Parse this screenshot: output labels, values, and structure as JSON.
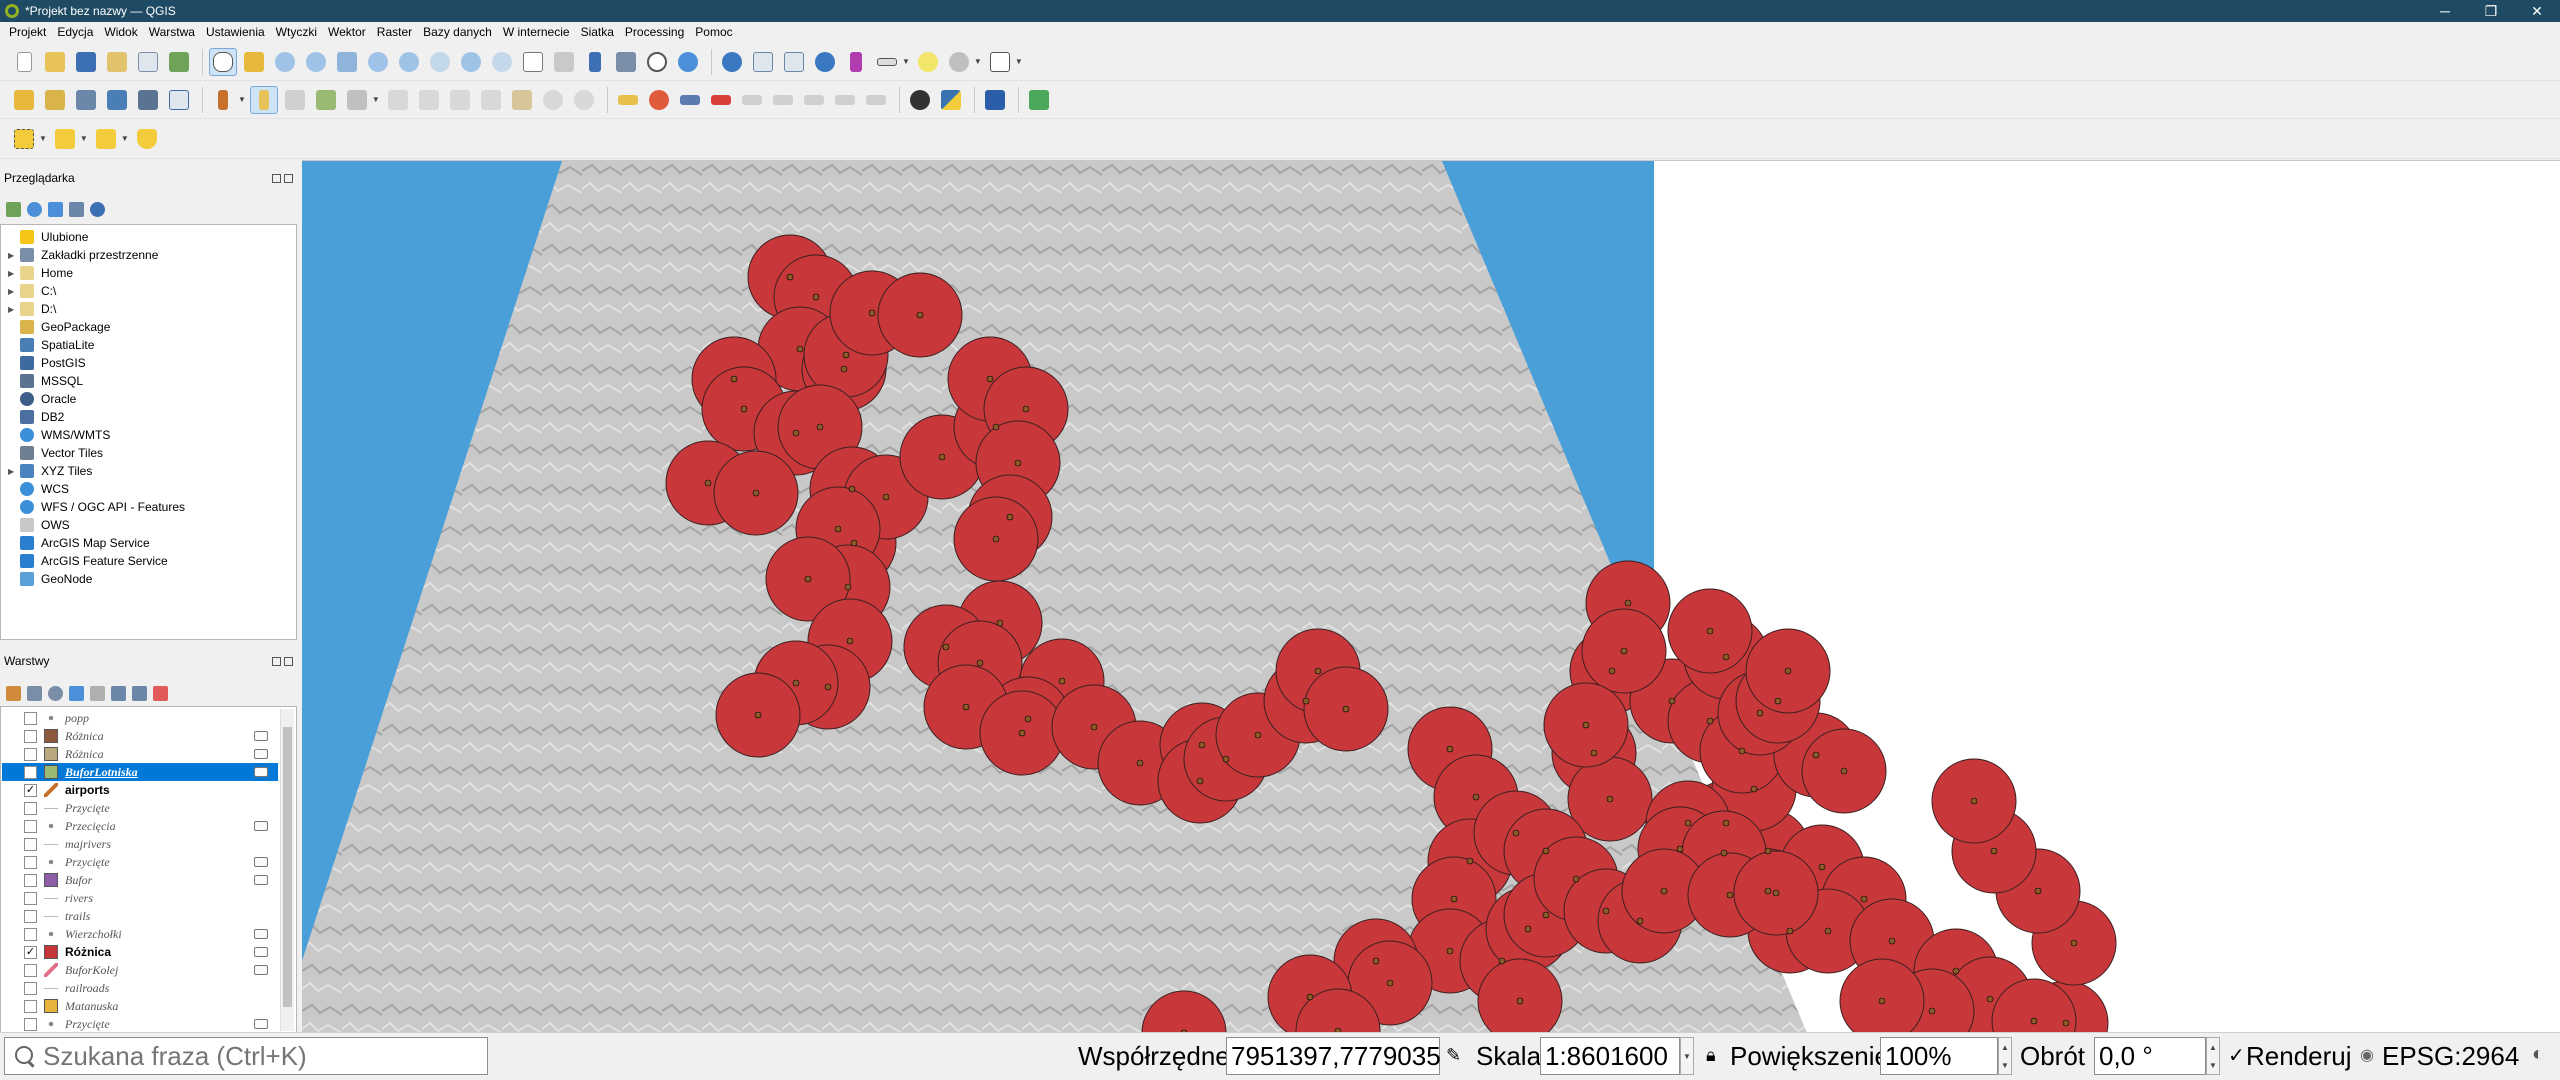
{
  "window": {
    "title": "*Projekt bez nazwy — QGIS",
    "minimize": "─",
    "maximize": "❐",
    "close": "✕"
  },
  "menu": [
    "Projekt",
    "Edycja",
    "Widok",
    "Warstwa",
    "Ustawienia",
    "Wtyczki",
    "Wektor",
    "Raster",
    "Bazy danych",
    "W internecie",
    "Siatka",
    "Processing",
    "Pomoc"
  ],
  "browser": {
    "title": "Przeglądarka",
    "items": [
      {
        "label": "Ulubione",
        "icon": "star-icon",
        "color": "#f5c518",
        "expand": false
      },
      {
        "label": "Zakładki przestrzenne",
        "icon": "bookmark-icon",
        "color": "#7a8ea8",
        "expand": true
      },
      {
        "label": "Home",
        "icon": "folder-icon",
        "color": "#e8d48a",
        "expand": true
      },
      {
        "label": "C:\\",
        "icon": "folder-icon",
        "color": "#e8d48a",
        "expand": true
      },
      {
        "label": "D:\\",
        "icon": "folder-icon",
        "color": "#e8d48a",
        "expand": true
      },
      {
        "label": "GeoPackage",
        "icon": "geopackage-icon",
        "color": "#d8b44a",
        "expand": false
      },
      {
        "label": "SpatiaLite",
        "icon": "spatialite-icon",
        "color": "#4a7fb5",
        "expand": false
      },
      {
        "label": "PostGIS",
        "icon": "postgis-icon",
        "color": "#3d6aa0",
        "expand": false
      },
      {
        "label": "MSSQL",
        "icon": "mssql-icon",
        "color": "#5a7390",
        "expand": false
      },
      {
        "label": "Oracle",
        "icon": "oracle-icon",
        "color": "#3e5e8a",
        "expand": false
      },
      {
        "label": "DB2",
        "icon": "db2-icon",
        "color": "#4b6fa0",
        "expand": false
      },
      {
        "label": "WMS/WMTS",
        "icon": "globe-icon",
        "color": "#3a8fd8",
        "expand": false
      },
      {
        "label": "Vector Tiles",
        "icon": "grid-icon",
        "color": "#6d7f91",
        "expand": false
      },
      {
        "label": "XYZ Tiles",
        "icon": "grid-icon",
        "color": "#4b82c0",
        "expand": true
      },
      {
        "label": "WCS",
        "icon": "globe-icon",
        "color": "#3a8fd8",
        "expand": false
      },
      {
        "label": "WFS / OGC API - Features",
        "icon": "globe-icon",
        "color": "#3a8fd8",
        "expand": false
      },
      {
        "label": "OWS",
        "icon": "ows-icon",
        "color": "#c7c7c7",
        "expand": false
      },
      {
        "label": "ArcGIS Map Service",
        "icon": "arcgis-icon",
        "color": "#2a7fd0",
        "expand": false
      },
      {
        "label": "ArcGIS Feature Service",
        "icon": "arcgis-icon",
        "color": "#2a7fd0",
        "expand": false
      },
      {
        "label": "GeoNode",
        "icon": "geonode-icon",
        "color": "#5aa0d8",
        "expand": false
      }
    ]
  },
  "layers": {
    "title": "Warstwy",
    "items": [
      {
        "name": "popp",
        "checked": false,
        "symbol": "dot",
        "color": "#888888",
        "bold": false,
        "selected": false,
        "filter": false
      },
      {
        "name": "Różnica",
        "checked": false,
        "symbol": "fill",
        "color": "#8b5a3c",
        "bold": false,
        "selected": false,
        "filter": true
      },
      {
        "name": "Różnica",
        "checked": false,
        "symbol": "fill",
        "color": "#b9a87e",
        "bold": false,
        "selected": false,
        "filter": true
      },
      {
        "name": "BuforLotniska",
        "checked": false,
        "symbol": "fill",
        "color": "#9ab973",
        "bold": false,
        "selected": true,
        "filter": true
      },
      {
        "name": "airports",
        "checked": true,
        "symbol": "pen",
        "color": "#c7722c",
        "bold": true,
        "selected": false,
        "filter": false
      },
      {
        "name": "Przycięte",
        "checked": false,
        "symbol": "line",
        "color": "#bbbbbb",
        "bold": false,
        "selected": false,
        "filter": false
      },
      {
        "name": "Przecięcia",
        "checked": false,
        "symbol": "dot",
        "color": "#888888",
        "bold": false,
        "selected": false,
        "filter": true
      },
      {
        "name": "majrivers",
        "checked": false,
        "symbol": "line",
        "color": "#bbbbbb",
        "bold": false,
        "selected": false,
        "filter": false
      },
      {
        "name": "Przycięte",
        "checked": false,
        "symbol": "dot",
        "color": "#888888",
        "bold": false,
        "selected": false,
        "filter": true
      },
      {
        "name": "Bufor",
        "checked": false,
        "symbol": "fill",
        "color": "#8e5fa8",
        "bold": false,
        "selected": false,
        "filter": true
      },
      {
        "name": "rivers",
        "checked": false,
        "symbol": "line",
        "color": "#bbbbbb",
        "bold": false,
        "selected": false,
        "filter": false
      },
      {
        "name": "trails",
        "checked": false,
        "symbol": "line",
        "color": "#bbbbbb",
        "bold": false,
        "selected": false,
        "filter": false
      },
      {
        "name": "Wierzchołki",
        "checked": false,
        "symbol": "dot",
        "color": "#888888",
        "bold": false,
        "selected": false,
        "filter": true
      },
      {
        "name": "Różnica",
        "checked": true,
        "symbol": "fill",
        "color": "#c8373a",
        "bold": true,
        "selected": false,
        "filter": true
      },
      {
        "name": "BuforKolej",
        "checked": false,
        "symbol": "pen",
        "color": "#e0708c",
        "bold": false,
        "selected": false,
        "filter": true
      },
      {
        "name": "railroads",
        "checked": false,
        "symbol": "line",
        "color": "#bbbbbb",
        "bold": false,
        "selected": false,
        "filter": false
      },
      {
        "name": "Matanuska",
        "checked": false,
        "symbol": "fill",
        "color": "#e8b33c",
        "bold": false,
        "selected": false,
        "filter": false
      },
      {
        "name": "Przycięte",
        "checked": false,
        "symbol": "dot",
        "color": "#888888",
        "bold": false,
        "selected": false,
        "filter": true
      }
    ]
  },
  "map": {
    "ocean_color": "#4a9fd8",
    "land_color": "#c9c9c9",
    "buffer_color": "#c8373a",
    "airport_color": "#8a5a2a"
  },
  "status": {
    "search_placeholder": "Szukana fraza (Ctrl+K)",
    "coordinates_label": "Współrzędne",
    "coordinates_value": "7951397,7779035",
    "scale_label": "Skala",
    "scale_value": "1:8601600",
    "magnifier_label": "Powiększenie",
    "magnifier_value": "100%",
    "rotation_label": "Obrót",
    "rotation_value": "0,0 °",
    "render_label": "Renderuj",
    "render_checked": true,
    "crs_label": "EPSG:2964"
  }
}
